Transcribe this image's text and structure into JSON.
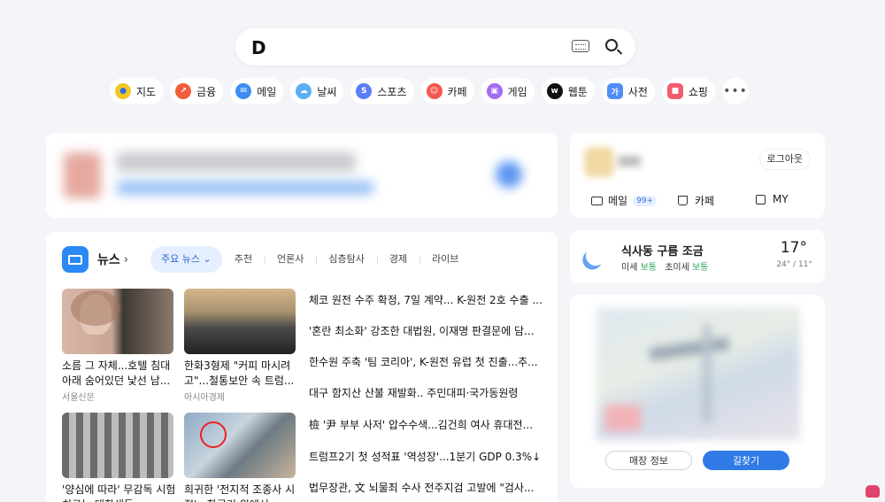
{
  "search": {
    "logo": "D"
  },
  "quick_links": [
    {
      "label": "지도",
      "icon": "map-pin-icon",
      "color": "#f3c623",
      "glyph": "●"
    },
    {
      "label": "금융",
      "icon": "finance-chart-icon",
      "color": "#f25c3d",
      "glyph": "↗"
    },
    {
      "label": "메일",
      "icon": "mail-icon",
      "color": "#3d8cf2",
      "glyph": "✉"
    },
    {
      "label": "날씨",
      "icon": "weather-icon",
      "color": "#5aaef5",
      "glyph": "☁"
    },
    {
      "label": "스포츠",
      "icon": "sports-icon",
      "color": "#5a7ef5",
      "glyph": "S"
    },
    {
      "label": "카페",
      "icon": "cafe-icon",
      "color": "#f5564e",
      "glyph": "☺"
    },
    {
      "label": "게임",
      "icon": "game-icon",
      "color": "#a26cf2",
      "glyph": "▣"
    },
    {
      "label": "웹툰",
      "icon": "webtoon-icon",
      "color": "#111111",
      "glyph": "w"
    },
    {
      "label": "사전",
      "icon": "dictionary-icon",
      "color": "#4f8ef7",
      "glyph": "가"
    },
    {
      "label": "쇼핑",
      "icon": "shopping-icon",
      "color": "#f25c6f",
      "glyph": "■"
    }
  ],
  "more_label": "•••",
  "news": {
    "title": "뉴스",
    "tabs": [
      "주요 뉴스",
      "추천",
      "언론사",
      "심층탐사",
      "경제",
      "라이브"
    ],
    "cards": [
      {
        "caption": "소름 그 자체...호텔 침대 아래 숨어있던 낯선 남...",
        "source": "서울신문"
      },
      {
        "caption": "한화3형제 \"커피 마시려 고\"...철통보안 속 트럼...",
        "source": "아시아경제"
      },
      {
        "caption": "'양심에 따라' 무감독 시험 치르는 대학생들",
        "source": ""
      },
      {
        "caption": "희귀한 '전지적 조종사 시점'...항공기 위에서...",
        "source": ""
      }
    ],
    "headlines": [
      "체코 원전 수주 확정, 7일 계약... K-원전 2호 수출 ...",
      "'혼란 최소화' 강조한 대법원, 이재명 판결문에 담...",
      "한수원 주축 '팀 코리아', K-원전 유럽 첫 진출...추...",
      "대구 함지산 산불 재발화.. 주민대피·국가동원령",
      "檢 '尹 부부 사저' 압수수색...김건희 여사 휴대전...",
      "트럼프2기 첫 성적표 '역성장'...1분기 GDP 0.3%↓",
      "법무장관, 文 뇌물죄 수사 전주지검 고발에 \"검사..."
    ]
  },
  "profile": {
    "logout_label": "로그아웃",
    "mail_label": "메일",
    "mail_badge": "99+",
    "cafe_label": "카페",
    "my_label": "MY"
  },
  "weather": {
    "location": "식사동 구름 조금",
    "temp": "17°",
    "dust_label": "미세",
    "dust_value": "보통",
    "fine_dust_label": "초미세",
    "fine_dust_value": "보통",
    "range": "24° / 11°"
  },
  "map": {
    "store_info_label": "매장 정보",
    "directions_label": "길찾기"
  }
}
